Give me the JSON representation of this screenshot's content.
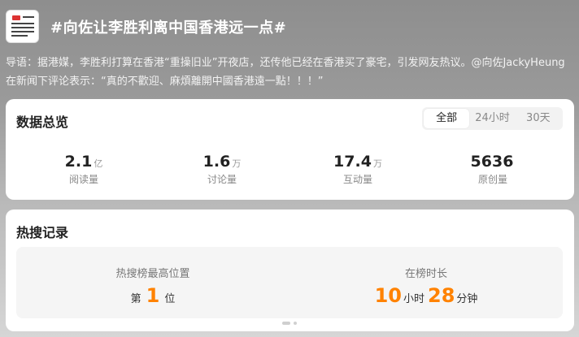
{
  "topic": {
    "title": "#向佐让李胜利离中国香港远一点#",
    "intro": "导语：据港媒，李胜利打算在香港“重操旧业”开夜店，还传他已经在香港买了豪宅，引发网友热议。@向佐JackyHeung 在新闻下评论表示：“真的不歡迎、麻煩離開中國香港遠一點！！！”",
    "thumb_icon": "news-thumbnail"
  },
  "overview": {
    "title": "数据总览",
    "tabs": [
      {
        "label": "全部",
        "active": true
      },
      {
        "label": "24小时",
        "active": false
      },
      {
        "label": "30天",
        "active": false
      }
    ],
    "stats": [
      {
        "value": "2.1",
        "unit": "亿",
        "label": "阅读量"
      },
      {
        "value": "1.6",
        "unit": "万",
        "label": "讨论量"
      },
      {
        "value": "17.4",
        "unit": "万",
        "label": "互动量"
      },
      {
        "value": "5636",
        "unit": "",
        "label": "原创量"
      }
    ]
  },
  "hot": {
    "title": "热搜记录",
    "peak": {
      "label": "热搜榜最高位置",
      "prefix": "第",
      "value": "1",
      "suffix": "位"
    },
    "duration": {
      "label": "在榜时长",
      "hours": "10",
      "hours_unit": "小时",
      "minutes": "28",
      "minutes_unit": "分钟"
    }
  },
  "colors": {
    "accent": "#ff8200",
    "card_bg": "#ffffff",
    "panel_bg": "#f5f5f5"
  }
}
